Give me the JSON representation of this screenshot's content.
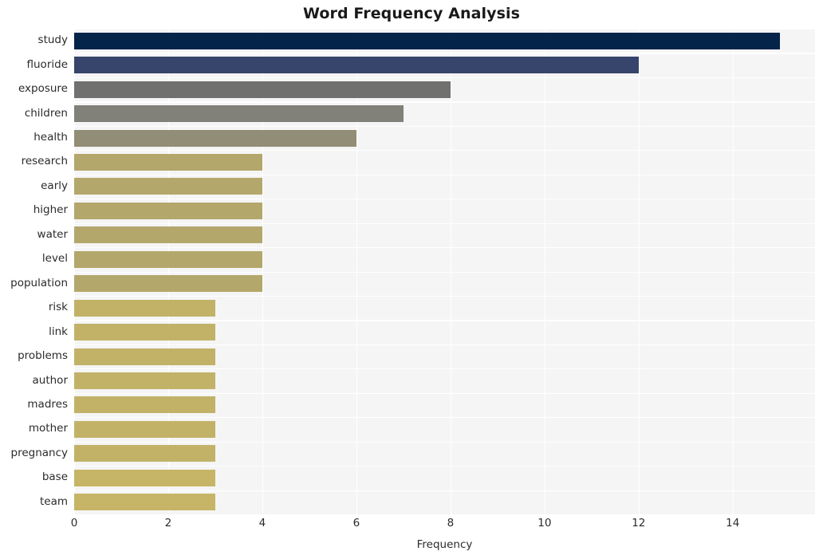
{
  "chart_data": {
    "type": "bar",
    "orientation": "horizontal",
    "title": "Word Frequency Analysis",
    "xlabel": "Frequency",
    "ylabel": "",
    "categories": [
      "study",
      "fluoride",
      "exposure",
      "children",
      "health",
      "research",
      "early",
      "higher",
      "water",
      "level",
      "population",
      "risk",
      "link",
      "problems",
      "author",
      "madres",
      "mother",
      "pregnancy",
      "base",
      "team"
    ],
    "values": [
      15,
      12,
      8,
      7,
      6,
      4,
      4,
      4,
      4,
      4,
      4,
      3,
      3,
      3,
      3,
      3,
      3,
      3,
      3,
      3
    ],
    "bar_colors": [
      "#052449",
      "#37446b",
      "#70706f",
      "#828179",
      "#918d77",
      "#b3a76b",
      "#b3a76b",
      "#b3a76b",
      "#b3a76b",
      "#b3a76b",
      "#b3a76b",
      "#c2b268",
      "#c2b268",
      "#c2b268",
      "#c2b268",
      "#c2b268",
      "#c2b268",
      "#c2b268",
      "#c6b566",
      "#c6b566"
    ],
    "xlim": [
      0,
      15.75
    ],
    "ylim_categories": 20,
    "xticks": [
      0,
      2,
      4,
      6,
      8,
      10,
      12,
      14
    ],
    "xtick_labels": [
      "0",
      "2",
      "4",
      "6",
      "8",
      "10",
      "12",
      "14"
    ],
    "grid": true,
    "grid_color": "#ffffff",
    "plot_background": "#f5f5f5",
    "figure_background": "#ffffff",
    "legend": null,
    "legend_position": "none"
  }
}
